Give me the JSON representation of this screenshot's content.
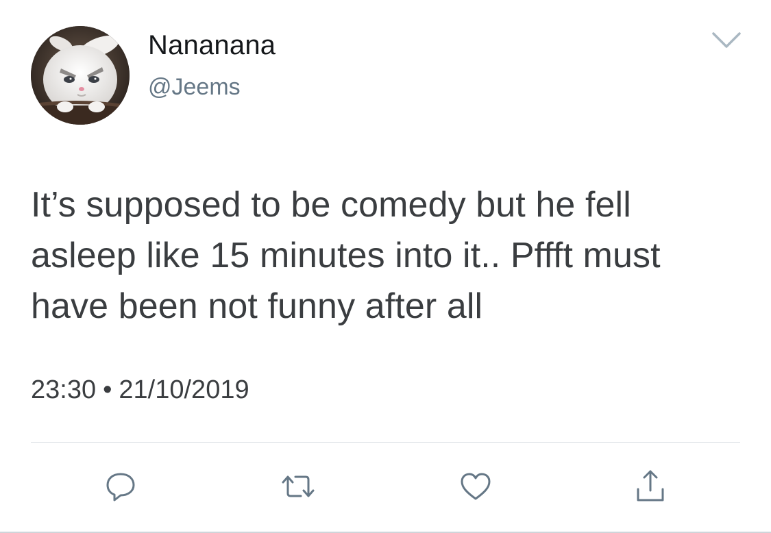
{
  "tweet": {
    "display_name": "Nananana",
    "handle": "@Jeems",
    "text": "It’s supposed to be comedy but he fell asleep like 15 minutes into it.. Pffft must have been not funny after all",
    "time": "23:30",
    "separator": "•",
    "date": "21/10/2019"
  },
  "icons": {
    "caret": "chevron-down-icon",
    "reply": "reply-icon",
    "retweet": "retweet-icon",
    "like": "heart-icon",
    "share": "share-icon"
  },
  "colors": {
    "text": "#3a3d40",
    "secondary": "#657786",
    "icon": "#657786",
    "divider": "#d8dde2"
  }
}
